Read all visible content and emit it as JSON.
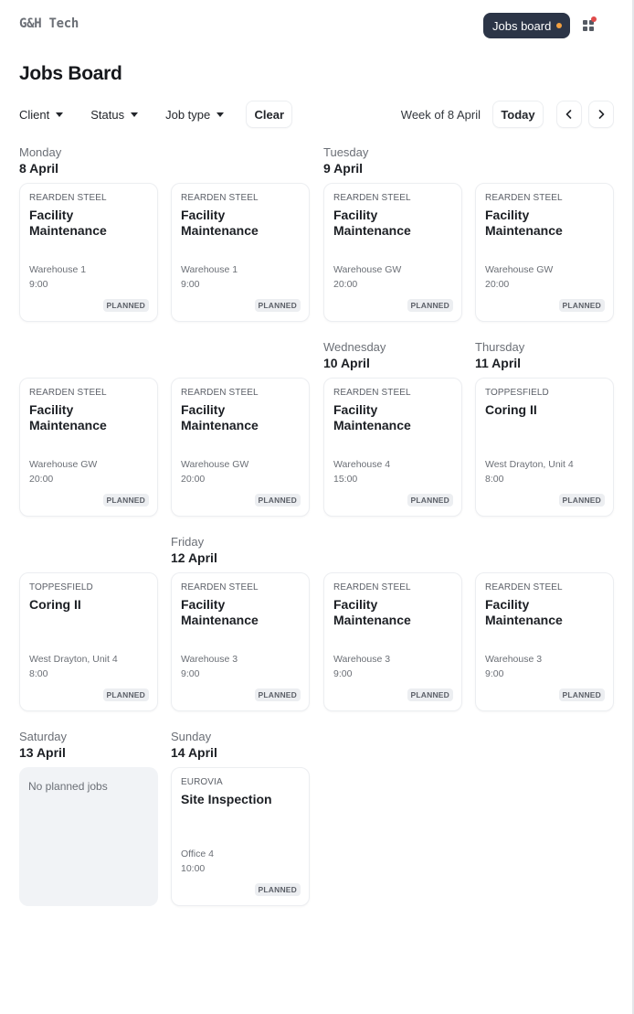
{
  "app": {
    "brand": "G&H Tech",
    "nav_button": {
      "label": "Jobs board",
      "indicator_color": "#f2a040"
    },
    "apps_icon": "grid-icon",
    "notification_color": "#e04a4a"
  },
  "page": {
    "title": "Jobs Board"
  },
  "filters": {
    "client": "Client",
    "status": "Status",
    "job_type": "Job type",
    "clear": "Clear"
  },
  "week_nav": {
    "label": "Week of 8 April",
    "today": "Today",
    "prev_icon": "chevron-left-icon",
    "next_icon": "chevron-right-icon"
  },
  "days": [
    {
      "name": "Monday",
      "date": "8 April"
    },
    {
      "name": "Tuesday",
      "date": "9 April"
    },
    {
      "name": "Wednesday",
      "date": "10 April"
    },
    {
      "name": "Thursday",
      "date": "11 April"
    },
    {
      "name": "Friday",
      "date": "12 April"
    },
    {
      "name": "Saturday",
      "date": "13 April",
      "empty_message": "No planned jobs"
    },
    {
      "name": "Sunday",
      "date": "14 April"
    }
  ],
  "jobs": [
    {
      "day": "Monday",
      "client": "REARDEN STEEL",
      "title": "Facility Maintenance",
      "location": "Warehouse 1",
      "time": "9:00",
      "status": "PLANNED"
    },
    {
      "day": "Monday",
      "client": "REARDEN STEEL",
      "title": "Facility Maintenance",
      "location": "Warehouse 1",
      "time": "9:00",
      "status": "PLANNED"
    },
    {
      "day": "Tuesday",
      "client": "REARDEN STEEL",
      "title": "Facility Maintenance",
      "location": "Warehouse GW",
      "time": "20:00",
      "status": "PLANNED"
    },
    {
      "day": "Tuesday",
      "client": "REARDEN STEEL",
      "title": "Facility Maintenance",
      "location": "Warehouse GW",
      "time": "20:00",
      "status": "PLANNED"
    },
    {
      "day": "Tuesday",
      "client": "REARDEN STEEL",
      "title": "Facility Maintenance",
      "location": "Warehouse GW",
      "time": "20:00",
      "status": "PLANNED"
    },
    {
      "day": "Tuesday",
      "client": "REARDEN STEEL",
      "title": "Facility Maintenance",
      "location": "Warehouse GW",
      "time": "20:00",
      "status": "PLANNED"
    },
    {
      "day": "Wednesday",
      "client": "REARDEN STEEL",
      "title": "Facility Maintenance",
      "location": "Warehouse 4",
      "time": "15:00",
      "status": "PLANNED"
    },
    {
      "day": "Thursday",
      "client": "TOPPESFIELD",
      "title": "Coring II",
      "location": "West Drayton, Unit 4",
      "time": "8:00",
      "status": "PLANNED"
    },
    {
      "day": "Thursday",
      "client": "TOPPESFIELD",
      "title": "Coring II",
      "location": "West Drayton, Unit 4",
      "time": "8:00",
      "status": "PLANNED"
    },
    {
      "day": "Friday",
      "client": "REARDEN STEEL",
      "title": "Facility Maintenance",
      "location": "Warehouse 3",
      "time": "9:00",
      "status": "PLANNED"
    },
    {
      "day": "Friday",
      "client": "REARDEN STEEL",
      "title": "Facility Maintenance",
      "location": "Warehouse 3",
      "time": "9:00",
      "status": "PLANNED"
    },
    {
      "day": "Friday",
      "client": "REARDEN STEEL",
      "title": "Facility Maintenance",
      "location": "Warehouse 3",
      "time": "9:00",
      "status": "PLANNED"
    },
    {
      "day": "Sunday",
      "client": "EUROVIA",
      "title": "Site Inspection",
      "location": "Office 4",
      "time": "10:00",
      "status": "PLANNED"
    }
  ]
}
